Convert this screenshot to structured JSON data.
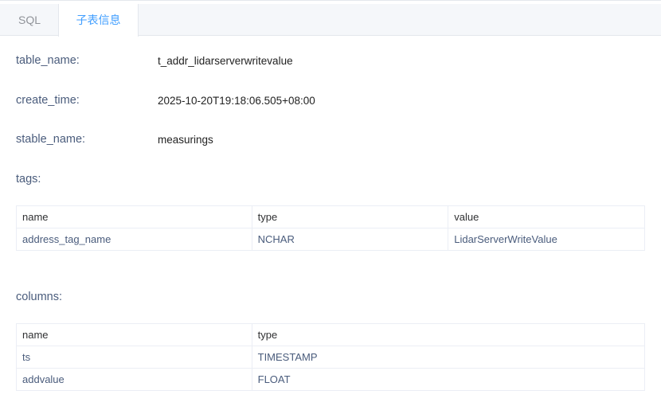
{
  "tabs": {
    "sql": "SQL",
    "subtable_info": "子表信息"
  },
  "fields": {
    "table_name": {
      "label": "table_name:",
      "value": "t_addr_lidarserverwritevalue"
    },
    "create_time": {
      "label": "create_time:",
      "value": "2025-10-20T19:18:06.505+08:00"
    },
    "stable_name": {
      "label": "stable_name:",
      "value": "measurings"
    }
  },
  "tags": {
    "label": "tags:",
    "headers": {
      "name": "name",
      "type": "type",
      "value": "value"
    },
    "rows": [
      {
        "name": "address_tag_name",
        "type": "NCHAR",
        "value": "LidarServerWriteValue"
      }
    ]
  },
  "columns": {
    "label": "columns:",
    "headers": {
      "name": "name",
      "type": "type"
    },
    "rows": [
      {
        "name": "ts",
        "type": "TIMESTAMP"
      },
      {
        "name": "addvalue",
        "type": "FLOAT"
      }
    ]
  },
  "colors": {
    "accent": "#409eff",
    "label": "#4a5c7c",
    "tab_bar": "#f5f7fa",
    "border": "#ebeef5"
  }
}
